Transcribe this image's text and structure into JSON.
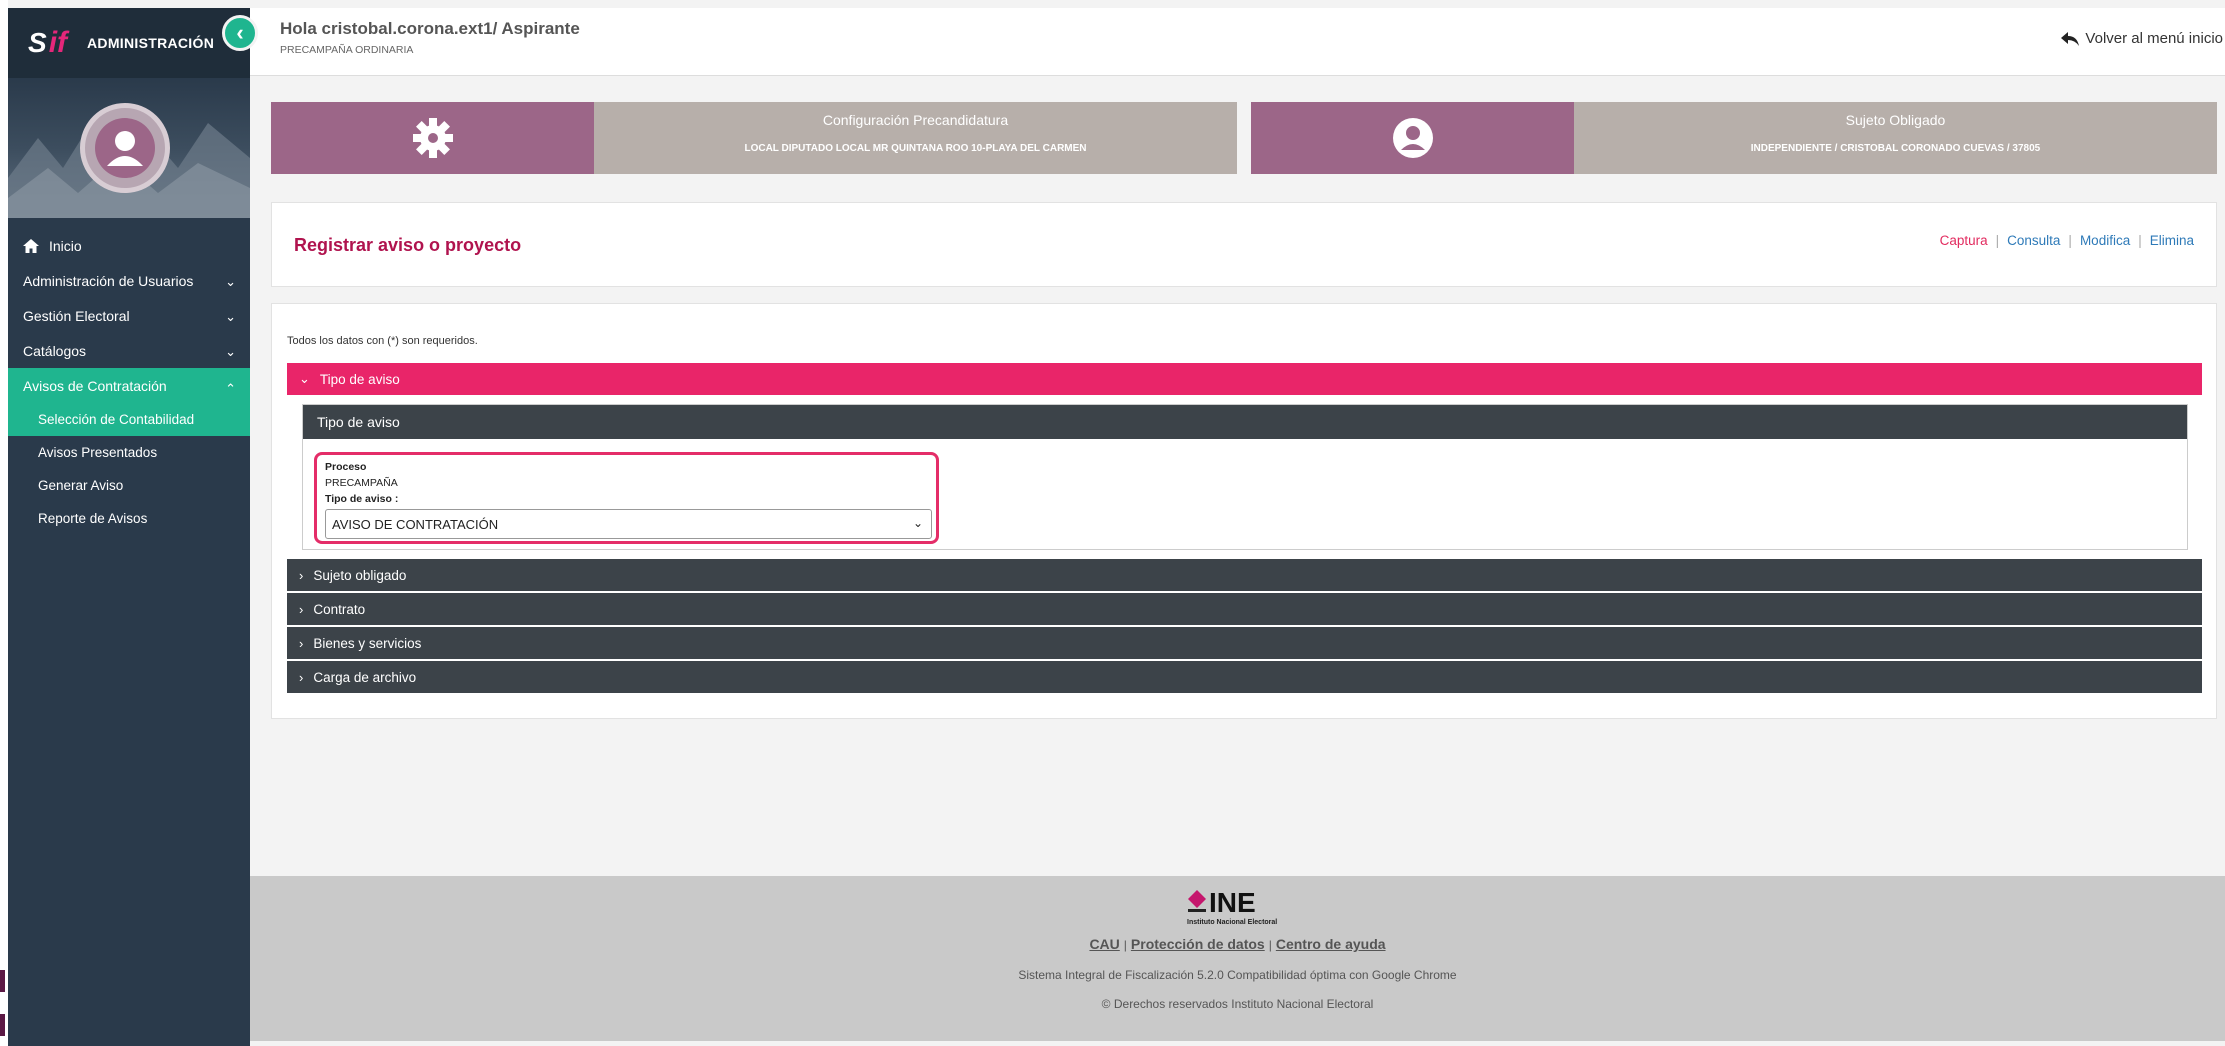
{
  "sidebar": {
    "brand_title": "ADMINISTRACIÓN",
    "logo_text": "SIF",
    "menu": {
      "inicio": "Inicio",
      "admin_usuarios": "Administración de Usuarios",
      "gestion_electoral": "Gestión Electoral",
      "catalogos": "Catálogos",
      "avisos": "Avisos de Contratación"
    },
    "submenu": [
      "Selección de Contabilidad",
      "Avisos Presentados",
      "Generar Aviso",
      "Reporte de Avisos"
    ]
  },
  "header": {
    "greeting": "Hola cristobal.corona.ext1/ Aspirante",
    "process": "PRECAMPAÑA ORDINARIA",
    "back_label": "Volver al menú inicio"
  },
  "cards": {
    "config": {
      "title": "Configuración Precandidatura",
      "detail": "LOCAL DIPUTADO LOCAL MR QUINTANA ROO 10-PLAYA DEL CARMEN"
    },
    "sujeto": {
      "title": "Sujeto Obligado",
      "detail": "INDEPENDIENTE / CRISTOBAL CORONADO CUEVAS / 37805"
    }
  },
  "page": {
    "title": "Registrar aviso o proyecto",
    "actions": {
      "captura": "Captura",
      "consulta": "Consulta",
      "modifica": "Modifica",
      "elimina": "Elimina"
    },
    "separator": "|"
  },
  "form": {
    "required_note": "Todos los datos con (*) son requeridos.",
    "tipo_aviso_section": "Tipo de aviso",
    "inner_header": "Tipo de aviso",
    "proceso_label": "Proceso",
    "proceso_value": "PRECAMPAÑA",
    "tipo_label": "Tipo de aviso :",
    "tipo_selected": "AVISO DE CONTRATACIÓN",
    "sections": {
      "sujeto": "Sujeto obligado",
      "contrato": "Contrato",
      "bienes": "Bienes y servicios",
      "carga": "Carga de archivo"
    }
  },
  "footer": {
    "logo_text": "INE",
    "logo_sub": "Instituto Nacional Electoral",
    "cau": "CAU",
    "proteccion": "Protección de datos",
    "ayuda": "Centro de ayuda",
    "system": "Sistema Integral de Fiscalización 5.2.0 Compatibilidad óptima con Google Chrome",
    "rights": "© Derechos reservados Instituto Nacional Electoral"
  },
  "colors": {
    "sidebar": "#2a3a4b",
    "accent_green": "#1fb58f",
    "accent_pink": "#e92569",
    "card_purple": "#9c6688",
    "title_red": "#b0134e"
  }
}
